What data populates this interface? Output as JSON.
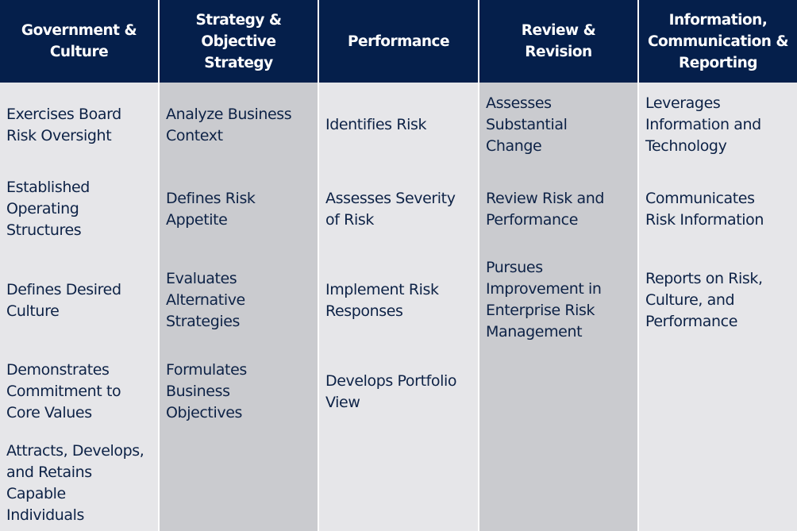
{
  "columns": [
    {
      "heading": [
        "Government &",
        "Culture"
      ],
      "items": [
        [
          "Exercises Board",
          "Risk Oversight"
        ],
        [
          "Established",
          "Operating",
          "Structures"
        ],
        [
          "Defines Desired",
          "Culture"
        ],
        [
          "Demonstrates",
          "Commitment to",
          "Core Values"
        ],
        [
          "Attracts, Develops,",
          "and Retains",
          "Capable",
          "Individuals"
        ]
      ]
    },
    {
      "heading": [
        "Strategy &",
        "Objective",
        "Strategy"
      ],
      "items": [
        [
          "Analyze Business",
          "Context"
        ],
        [
          "Defines Risk",
          "Appetite"
        ],
        [
          "Evaluates",
          "Alternative",
          "Strategies"
        ],
        [
          "Formulates",
          "Business",
          "Objectives"
        ]
      ]
    },
    {
      "heading": [
        "Performance"
      ],
      "items": [
        [
          "Identifies Risk"
        ],
        [
          "Assesses Severity",
          "of Risk"
        ],
        [
          "Implement Risk",
          "Responses"
        ],
        [
          "Develops Portfolio",
          "View"
        ]
      ]
    },
    {
      "heading": [
        "Review &",
        "Revision"
      ],
      "items": [
        [
          "Assesses",
          "Substantial",
          "Change"
        ],
        [
          "Review Risk and",
          "Performance"
        ],
        [
          "Pursues",
          "Improvement in",
          "Enterprise Risk",
          "Management"
        ]
      ]
    },
    {
      "heading": [
        "Information,",
        "Communication &",
        "Reporting"
      ],
      "items": [
        [
          "Leverages",
          "Information and",
          "Technology"
        ],
        [
          "Communicates",
          "Risk Information"
        ],
        [
          "Reports on Risk,",
          "Culture, and",
          "Performance"
        ]
      ]
    }
  ],
  "colors": {
    "header_bg": "#051f4b",
    "header_text": "#ffffff",
    "body_light": "#e6e6e9",
    "body_dark": "#cacbcf",
    "body_text": "#0d2246"
  }
}
